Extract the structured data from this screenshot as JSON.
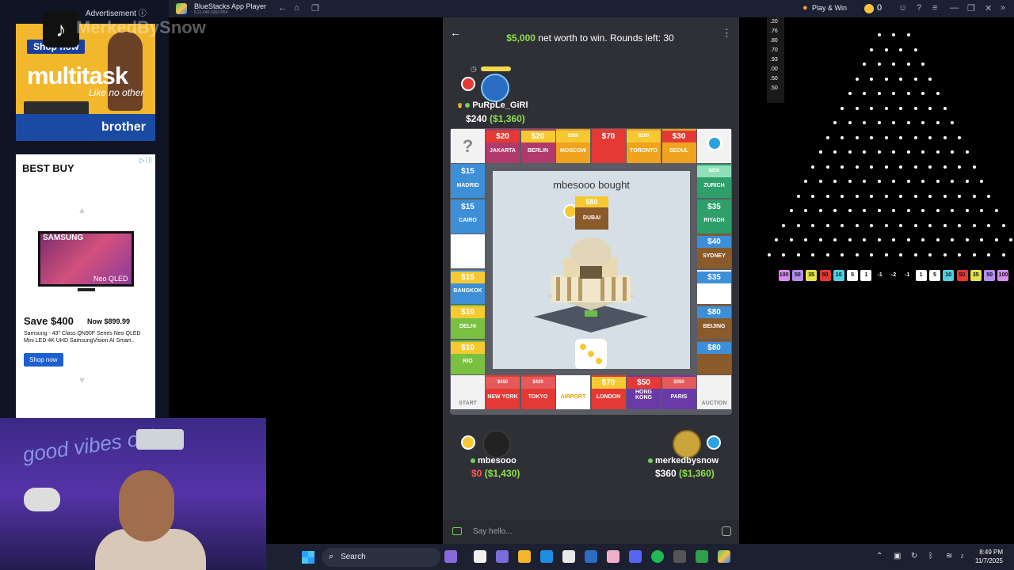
{
  "window": {
    "title": "BlueStacks App Player",
    "version": "5.21.640.1002 P64",
    "play_win": "Play & Win",
    "coins": "0"
  },
  "ads": {
    "label": "Advertisement",
    "watermark": "MerkedBySnow",
    "top": {
      "cta": "Shop now",
      "headline": "multitask",
      "tagline": "Like no other",
      "brand": "brother"
    },
    "bottom": {
      "logo": "BEST BUY",
      "tv_brand": "SAMSUNG",
      "tv_model": "Neo QLED",
      "save": "Save $400",
      "now_price": "Now $899.99",
      "description": "Samsung - 43\" Class QN90F Series Neo QLED Mini LED 4K UHD SamsungVision AI Smart..",
      "cta": "Shop now"
    }
  },
  "webcam": {
    "neon_text": "good vibes only"
  },
  "game": {
    "goal_money": "$5,000",
    "goal_text": "net worth to win. Rounds left: 30",
    "players": {
      "top": {
        "name": "PuRpLe_GiRl",
        "cash": "$240",
        "networth": "($1,360)"
      },
      "left": {
        "name": "mbesooo",
        "cash": "$0",
        "networth": "($1,430)"
      },
      "right": {
        "name": "merkedbysnow",
        "cash": "$360",
        "networth": "($1,360)"
      }
    },
    "center_text": "mbesooo bought",
    "bought_price": "$80",
    "bought_city": "DUBAI",
    "board": {
      "top": [
        {
          "price": "$20",
          "name": "JAKARTA"
        },
        {
          "price": "$20",
          "name": "BERLIN"
        },
        {
          "price": "$300",
          "name": "MOSCOW"
        },
        {
          "price": "$70",
          "name": ""
        },
        {
          "price": "$200",
          "name": "TORONTO"
        },
        {
          "price": "$30",
          "name": "SEOUL"
        }
      ],
      "left": [
        {
          "price": "$15",
          "name": "MADRID"
        },
        {
          "price": "$15",
          "name": "CAIRO"
        },
        {
          "price": "",
          "name": ""
        },
        {
          "price": "$15",
          "name": "BANGKOK"
        },
        {
          "price": "$10",
          "name": "DELHI"
        },
        {
          "price": "$10",
          "name": "RIO"
        }
      ],
      "right": [
        {
          "price": "$250",
          "name": "ZURICH"
        },
        {
          "price": "$35",
          "name": "RIYADH"
        },
        {
          "price": "$40",
          "name": "SYDNEY"
        },
        {
          "price": "$35",
          "name": ""
        },
        {
          "price": "$80",
          "name": "BEIJING"
        },
        {
          "price": "$80",
          "name": ""
        }
      ],
      "bottom": [
        {
          "price": "$450",
          "name": "NEW YORK"
        },
        {
          "price": "$420",
          "name": "TOKYO"
        },
        {
          "price": "",
          "name": "AIRPORT"
        },
        {
          "price": "$70",
          "name": "LONDON"
        },
        {
          "price": "$50",
          "name": "HONG KONG"
        },
        {
          "price": "$350",
          "name": "PARIS"
        }
      ],
      "corners": {
        "top_left": "?",
        "bottom_left": "START",
        "bottom_right": "AUCTION"
      }
    },
    "chat_placeholder": "Say hello..."
  },
  "plinko": {
    "history": [
      ".20",
      ".76",
      ".80",
      ".70",
      ".93",
      ".00",
      ".50",
      ".50"
    ],
    "multipliers": [
      {
        "v": "100",
        "c": "#d98cf0"
      },
      {
        "v": "50",
        "c": "#b78cf0"
      },
      {
        "v": "35",
        "c": "#e3e34a"
      },
      {
        "v": "50",
        "c": "#e53935"
      },
      {
        "v": "10",
        "c": "#4dd0e1"
      },
      {
        "v": "5",
        "c": "#ffffff"
      },
      {
        "v": "1",
        "c": "#ffffff"
      },
      {
        "v": "-1",
        "c": ""
      },
      {
        "v": "-2",
        "c": ""
      },
      {
        "v": "-1",
        "c": ""
      },
      {
        "v": "1",
        "c": "#ffffff"
      },
      {
        "v": "5",
        "c": "#ffffff"
      },
      {
        "v": "10",
        "c": "#4dd0e1"
      },
      {
        "v": "50",
        "c": "#e53935"
      },
      {
        "v": "35",
        "c": "#e3e34a"
      },
      {
        "v": "50",
        "c": "#b78cf0"
      },
      {
        "v": "100",
        "c": "#d98cf0"
      }
    ]
  },
  "taskbar": {
    "search": "Search",
    "time": "8:49 PM",
    "date": "11/7/2025"
  }
}
